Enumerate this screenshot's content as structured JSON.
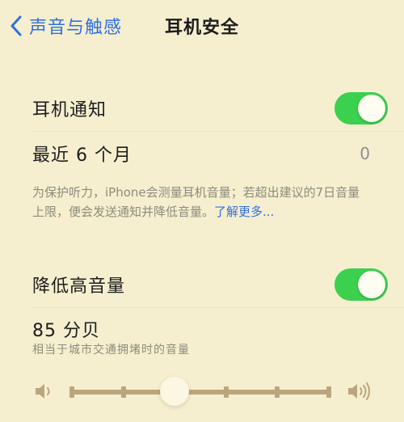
{
  "nav": {
    "back_label": "声音与触感",
    "title": "耳机安全"
  },
  "headphone_notifications": {
    "label": "耳机通知",
    "enabled": true
  },
  "last_6_months": {
    "label": "最近 6 个月",
    "value": "0"
  },
  "footer": {
    "text": "为保护听力，iPhone会测量耳机音量；若超出建议的7日音量上限，便会发送通知并降低音量。",
    "link": "了解更多..."
  },
  "reduce_loud_audio": {
    "label": "降低高音量",
    "enabled": true
  },
  "level": {
    "value": "85 分贝",
    "description": "相当于城市交通拥堵时的音量"
  },
  "slider": {
    "min_icon": "speaker-low-icon",
    "max_icon": "speaker-high-icon",
    "stops": 6,
    "selected_index": 2
  },
  "colors": {
    "background": "#f5efcf",
    "accent_blue": "#2f6fe6",
    "toggle_on": "#3bd14e"
  }
}
